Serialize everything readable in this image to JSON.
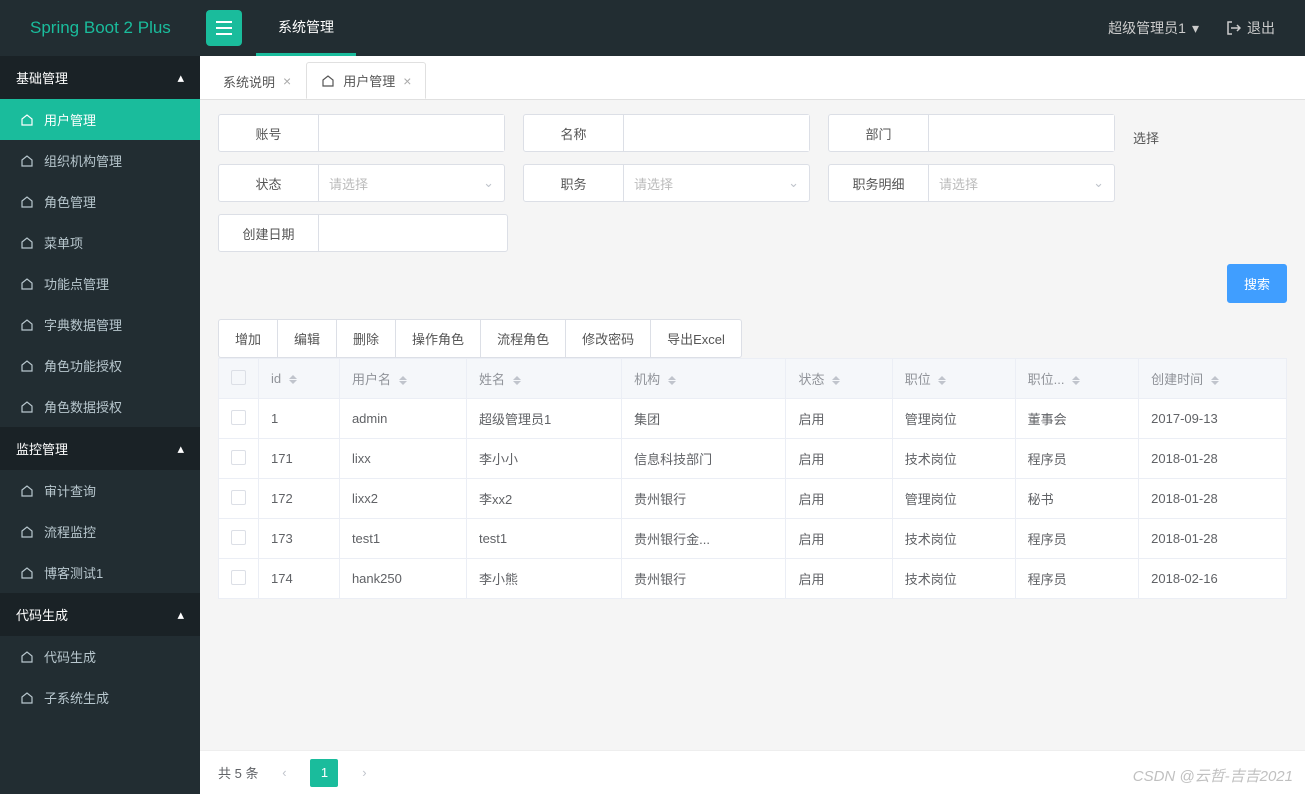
{
  "brand": "Spring Boot 2 Plus",
  "top_main_tab": "系统管理",
  "user_name": "超级管理员1",
  "logout_label": "退出",
  "sidebar": {
    "groups": [
      {
        "title": "基础管理",
        "items": [
          {
            "label": "用户管理",
            "active": true
          },
          {
            "label": "组织机构管理"
          },
          {
            "label": "角色管理"
          },
          {
            "label": "菜单项"
          },
          {
            "label": "功能点管理"
          },
          {
            "label": "字典数据管理"
          },
          {
            "label": "角色功能授权"
          },
          {
            "label": "角色数据授权"
          }
        ]
      },
      {
        "title": "监控管理",
        "items": [
          {
            "label": "审计查询"
          },
          {
            "label": "流程监控"
          },
          {
            "label": "博客测试1"
          }
        ]
      },
      {
        "title": "代码生成",
        "items": [
          {
            "label": "代码生成"
          },
          {
            "label": "子系统生成"
          }
        ]
      }
    ]
  },
  "subtabs": [
    {
      "label": "系统说明",
      "icon": false
    },
    {
      "label": "用户管理",
      "icon": true,
      "active": true
    }
  ],
  "filter": {
    "account": {
      "label": "账号",
      "value": ""
    },
    "name": {
      "label": "名称",
      "value": ""
    },
    "dept": {
      "label": "部门",
      "value": ""
    },
    "choose": "选择",
    "status": {
      "label": "状态",
      "placeholder": "请选择"
    },
    "position": {
      "label": "职务",
      "placeholder": "请选择"
    },
    "position_detail": {
      "label": "职务明细",
      "placeholder": "请选择"
    },
    "create_date": {
      "label": "创建日期",
      "value": ""
    },
    "search": "搜索"
  },
  "toolbar": [
    "增加",
    "编辑",
    "删除",
    "操作角色",
    "流程角色",
    "修改密码",
    "导出Excel"
  ],
  "table": {
    "columns": [
      "id",
      "用户名",
      "姓名",
      "机构",
      "状态",
      "职位",
      "职位...",
      "创建时间"
    ],
    "rows": [
      {
        "id": "1",
        "user": "admin",
        "name": "超级管理员1",
        "org": "集团",
        "status": "启用",
        "pos": "管理岗位",
        "posd": "董事会",
        "created": "2017-09-13"
      },
      {
        "id": "171",
        "user": "lixx",
        "name": "李小小",
        "org": "信息科技部门",
        "status": "启用",
        "pos": "技术岗位",
        "posd": "程序员",
        "created": "2018-01-28"
      },
      {
        "id": "172",
        "user": "lixx2",
        "name": "李xx2",
        "org": "贵州银行",
        "status": "启用",
        "pos": "管理岗位",
        "posd": "秘书",
        "created": "2018-01-28"
      },
      {
        "id": "173",
        "user": "test1",
        "name": "test1",
        "org": "贵州银行金...",
        "status": "启用",
        "pos": "技术岗位",
        "posd": "程序员",
        "created": "2018-01-28"
      },
      {
        "id": "174",
        "user": "hank250",
        "name": "李小熊",
        "org": "贵州银行",
        "status": "启用",
        "pos": "技术岗位",
        "posd": "程序员",
        "created": "2018-02-16"
      }
    ]
  },
  "pagination": {
    "total_label": "共 5 条",
    "current": "1"
  },
  "watermark": "CSDN @云哲-吉吉2021"
}
